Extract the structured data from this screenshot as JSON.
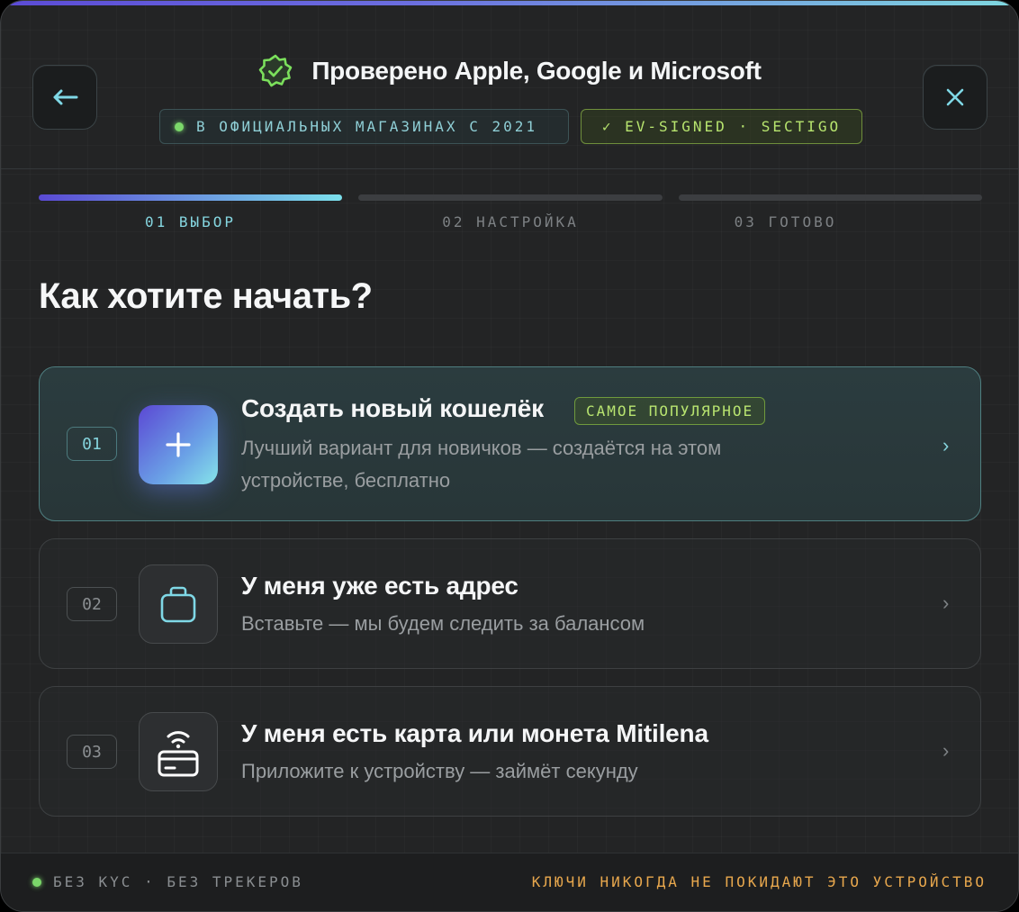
{
  "header": {
    "verified_title": "Проверено Apple, Google и Microsoft",
    "badge_stores": "В ОФИЦИАЛЬНЫХ МАГАЗИНАХ С 2021",
    "badge_ev": "✓ EV-SIGNED · SECTIGO",
    "back_icon": "arrow-left-icon",
    "close_icon": "close-icon"
  },
  "stepper": {
    "steps": [
      {
        "label": "01 ВЫБОР",
        "active": true
      },
      {
        "label": "02 НАСТРОЙКА",
        "active": false
      },
      {
        "label": "03 ГОТОВО",
        "active": false
      }
    ]
  },
  "question": "Как хотите начать?",
  "options": [
    {
      "number": "01",
      "title": "Создать новый кошелёк",
      "badge": "САМОЕ ПОПУЛЯРНОЕ",
      "desc_line1": "Лучший вариант для новичков — создаётся на этом",
      "desc_line2": "устройстве, бесплатно",
      "icon": "plus-icon",
      "chevron": "›"
    },
    {
      "number": "02",
      "title": "У меня уже есть адрес",
      "desc": "Вставьте — мы будем следить за балансом",
      "icon": "bag-icon",
      "chevron": "›"
    },
    {
      "number": "03",
      "title": "У меня есть карта или монета Mitilena",
      "desc": "Приложите к устройству — займёт секунду",
      "icon": "nfc-card-icon",
      "chevron": "›"
    }
  ],
  "footer": {
    "left": "БЕЗ KYC · БЕЗ ТРЕКЕРОВ",
    "right": "КЛЮЧИ НИКОГДА НЕ ПОКИДАЮТ ЭТО УСТРОЙСТВО"
  },
  "colors": {
    "accent_cyan": "#85d6e0",
    "accent_green": "#b7e46e",
    "accent_orange": "#e7a74d",
    "accent_purple": "#5b48d4"
  }
}
